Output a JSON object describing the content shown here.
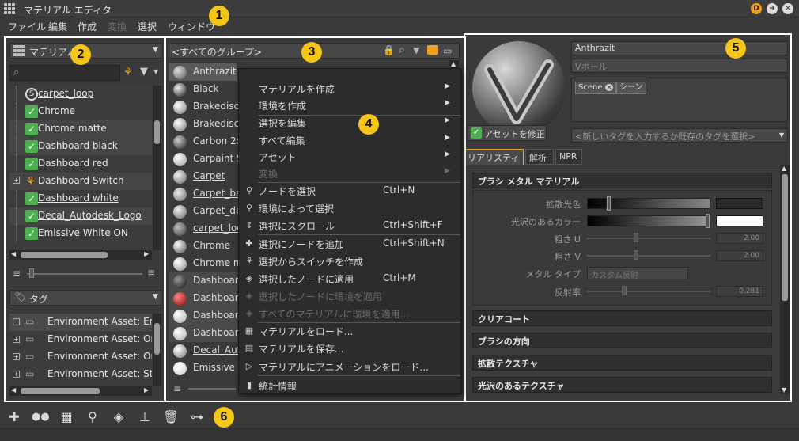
{
  "window": {
    "title": "マテリアル エディタ"
  },
  "menu": [
    "ファイル",
    "編集",
    "作成",
    "変換",
    "選択",
    "ウィンドウ"
  ],
  "menu_disabled": [
    "変換"
  ],
  "callouts": [
    "1",
    "2",
    "3",
    "4",
    "5",
    "6"
  ],
  "left_panel": {
    "combo_label": "マテリアル",
    "search_placeholder": "",
    "materials": [
      {
        "name": "carpet_loop",
        "kind": "s",
        "underline": true
      },
      {
        "name": "Chrome",
        "kind": "check",
        "underline": false
      },
      {
        "name": "Chrome matte",
        "kind": "check",
        "underline": false
      },
      {
        "name": "Dashboard black",
        "kind": "check",
        "underline": false
      },
      {
        "name": "Dashboard red",
        "kind": "check",
        "underline": false
      },
      {
        "name": "Dashboard Switch",
        "kind": "switch",
        "underline": false
      },
      {
        "name": "Dashboard white",
        "kind": "check",
        "underline": true
      },
      {
        "name": "Decal_Autodesk_Logo",
        "kind": "check",
        "underline": true
      },
      {
        "name": "Emissive White ON",
        "kind": "check",
        "underline": false
      }
    ],
    "tag_combo_label": "タグ",
    "tags": [
      "Environment Asset: Empt",
      "Environment Asset: Oran",
      "Environment Asset: Outd",
      "Environment Asset: Studi"
    ]
  },
  "middle_panel": {
    "header": "<すべてのグループ>",
    "materials": [
      "Anthrazit",
      "Black",
      "Brakedisc R",
      "Brakedisc R",
      "Carbon 2x",
      "Carpaint Sw",
      "Carpet",
      "Carpet_bas",
      "Carpet_dec",
      "carpet_loop",
      "Chrome",
      "Chrome ma",
      "Dashboard",
      "Dashboard",
      "Dashboard",
      "Dashboard",
      "Decal_Auto",
      "Emissive W"
    ]
  },
  "context_menu": [
    {
      "label": "マテリアルを作成",
      "shortcut": "",
      "submenu": true,
      "disabled": false,
      "icon": ""
    },
    {
      "label": "環境を作成",
      "shortcut": "",
      "submenu": true,
      "disabled": false,
      "icon": ""
    },
    {
      "label": "選択を編集",
      "shortcut": "",
      "submenu": true,
      "disabled": false,
      "icon": ""
    },
    {
      "label": "すべて編集",
      "shortcut": "",
      "submenu": true,
      "disabled": false,
      "icon": ""
    },
    {
      "label": "アセット",
      "shortcut": "",
      "submenu": true,
      "disabled": false,
      "icon": ""
    },
    {
      "label": "変換",
      "shortcut": "",
      "submenu": true,
      "disabled": true,
      "icon": ""
    },
    {
      "label": "ノードを選択",
      "shortcut": "Ctrl+N",
      "submenu": false,
      "disabled": false,
      "icon": "select-node-icon"
    },
    {
      "label": "環境によって選択",
      "shortcut": "",
      "submenu": false,
      "disabled": false,
      "icon": "select-by-env-icon"
    },
    {
      "label": "選択にスクロール",
      "shortcut": "Ctrl+Shift+F",
      "submenu": false,
      "disabled": false,
      "icon": "scroll-icon"
    },
    {
      "label": "選択にノードを追加",
      "shortcut": "Ctrl+Shift+N",
      "submenu": false,
      "disabled": false,
      "icon": "add-node-icon"
    },
    {
      "label": "選択からスイッチを作成",
      "shortcut": "",
      "submenu": false,
      "disabled": false,
      "icon": "switch-icon"
    },
    {
      "label": "選択したノードに適用",
      "shortcut": "Ctrl+M",
      "submenu": false,
      "disabled": false,
      "icon": "apply-icon"
    },
    {
      "label": "選択したノードに環境を適用",
      "shortcut": "",
      "submenu": false,
      "disabled": true,
      "icon": "apply-env-icon"
    },
    {
      "label": "すべてのマテリアルに環境を適用...",
      "shortcut": "",
      "submenu": false,
      "disabled": true,
      "icon": "apply-env-all-icon"
    },
    {
      "label": "マテリアルをロード...",
      "shortcut": "",
      "submenu": false,
      "disabled": false,
      "icon": "load-icon"
    },
    {
      "label": "マテリアルを保存...",
      "shortcut": "",
      "submenu": false,
      "disabled": false,
      "icon": "save-icon"
    },
    {
      "label": "マテリアルにアニメーションをロード...",
      "shortcut": "",
      "submenu": false,
      "disabled": false,
      "icon": "anim-icon"
    },
    {
      "label": "統計情報",
      "shortcut": "",
      "submenu": false,
      "disabled": false,
      "icon": "stats-icon"
    }
  ],
  "right_panel": {
    "material_name": "Anthrazit",
    "type_label": "Vボール",
    "tags": [
      "Scene",
      "シーン"
    ],
    "fix_asset_button": "アセットを修正",
    "tag_input_placeholder": "<新しいタグを入力するか既存のタグを選択>",
    "tabs": [
      "リアリスティック",
      "解析",
      "NPR"
    ],
    "active_tab": 0,
    "section_main": "ブラシ メタル マテリアル",
    "properties": [
      {
        "label": "拡散光色",
        "type": "color",
        "value": ""
      },
      {
        "label": "光沢のあるカラー",
        "type": "color",
        "value": ""
      },
      {
        "label": "粗さ U",
        "type": "slider",
        "value": "2.00"
      },
      {
        "label": "粗さ V",
        "type": "slider",
        "value": "2.00"
      },
      {
        "label": "メタル タイプ",
        "type": "combo",
        "value": "カスタム反射"
      },
      {
        "label": "反射率",
        "type": "slider",
        "value": "0.281"
      }
    ],
    "sections": [
      "クリアコート",
      "ブラシの方向",
      "拡散テクスチャ",
      "光沢のあるテクスチャ"
    ]
  },
  "bottom_toolbar": [
    "add-icon",
    "dots-icon",
    "grid-select-icon",
    "select-node-icon",
    "apply-icon",
    "brush-icon",
    "trash-icon",
    "graph-icon"
  ],
  "colors": {
    "badge": "#f5c518",
    "accent": "#4caf50",
    "frame": "#ffffff"
  }
}
